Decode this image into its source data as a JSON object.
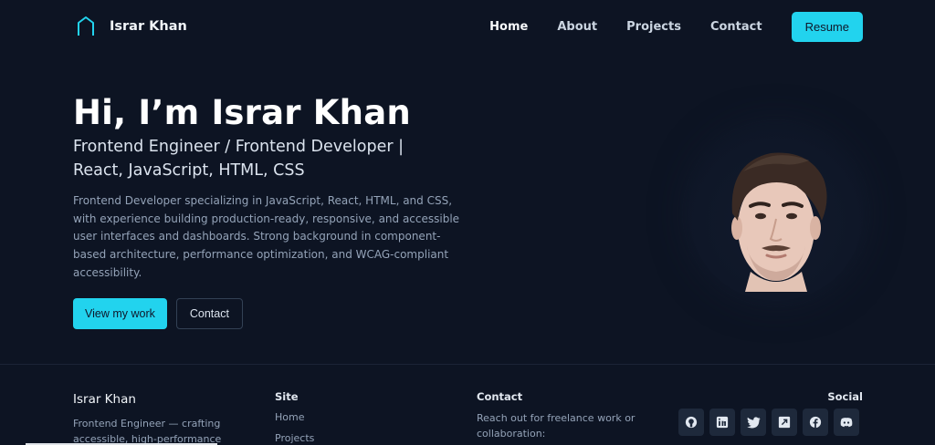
{
  "navbar": {
    "brand_name": "Israr Khan",
    "links": [
      "Home",
      "About",
      "Projects",
      "Contact"
    ],
    "resume_label": "Resume"
  },
  "hero": {
    "title": "Hi, I’m Israr Khan",
    "subtitle": "Frontend Engineer / Frontend Developer | React, JavaScript, HTML, CSS",
    "description": "Frontend Developer specializing in JavaScript, React, HTML, and CSS, with experience building production-ready, responsive, and accessible user interfaces and dashboards. Strong background in component-based architecture, performance optimization, and WCAG-compliant accessibility.",
    "primary_button": "View my work",
    "secondary_button": "Contact"
  },
  "footer": {
    "brand": "Israr Khan",
    "tagline": "Frontend Engineer — crafting accessible, high-performance interfaces.",
    "site_title": "Site",
    "site_links": [
      "Home",
      "Projects"
    ],
    "contact_title": "Contact",
    "contact_text": "Reach out for freelance work or collaboration:",
    "social_title": "Social",
    "social_icons": [
      "github-icon",
      "linkedin-icon",
      "twitter-icon",
      "external-link-icon",
      "facebook-icon",
      "discord-icon"
    ]
  },
  "colors": {
    "background": "#0d1423",
    "accent": "#22d3ee",
    "muted_text": "#94a3b8"
  }
}
